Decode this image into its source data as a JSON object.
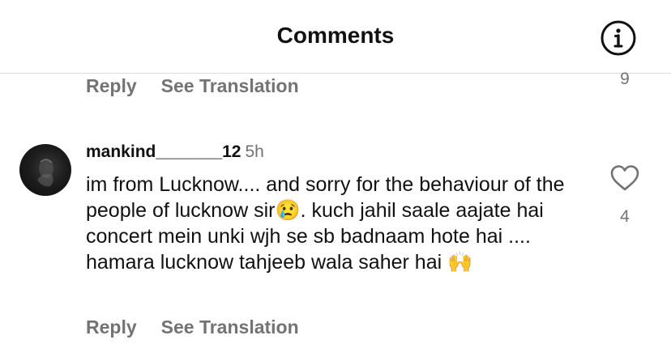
{
  "header": {
    "title": "Comments",
    "info_icon": "info-circle-icon"
  },
  "previous_comment": {
    "reply_label": "Reply",
    "see_translation_label": "See Translation",
    "like_count": "9"
  },
  "comment": {
    "username": "mankind_______12",
    "timestamp": "5h",
    "text_part1": "im from Lucknow.... and sorry for the behaviour of the people of lucknow sir",
    "emoji1": "😢",
    "text_part2": ". kuch jahil saale aajate hai concert mein unki wjh se sb badnaam hote hai .... hamara lucknow tahjeeb wala saher hai ",
    "emoji2": "🙌",
    "like_icon": "heart-outline-icon",
    "like_count": "4",
    "reply_label": "Reply",
    "see_translation_label": "See Translation"
  }
}
